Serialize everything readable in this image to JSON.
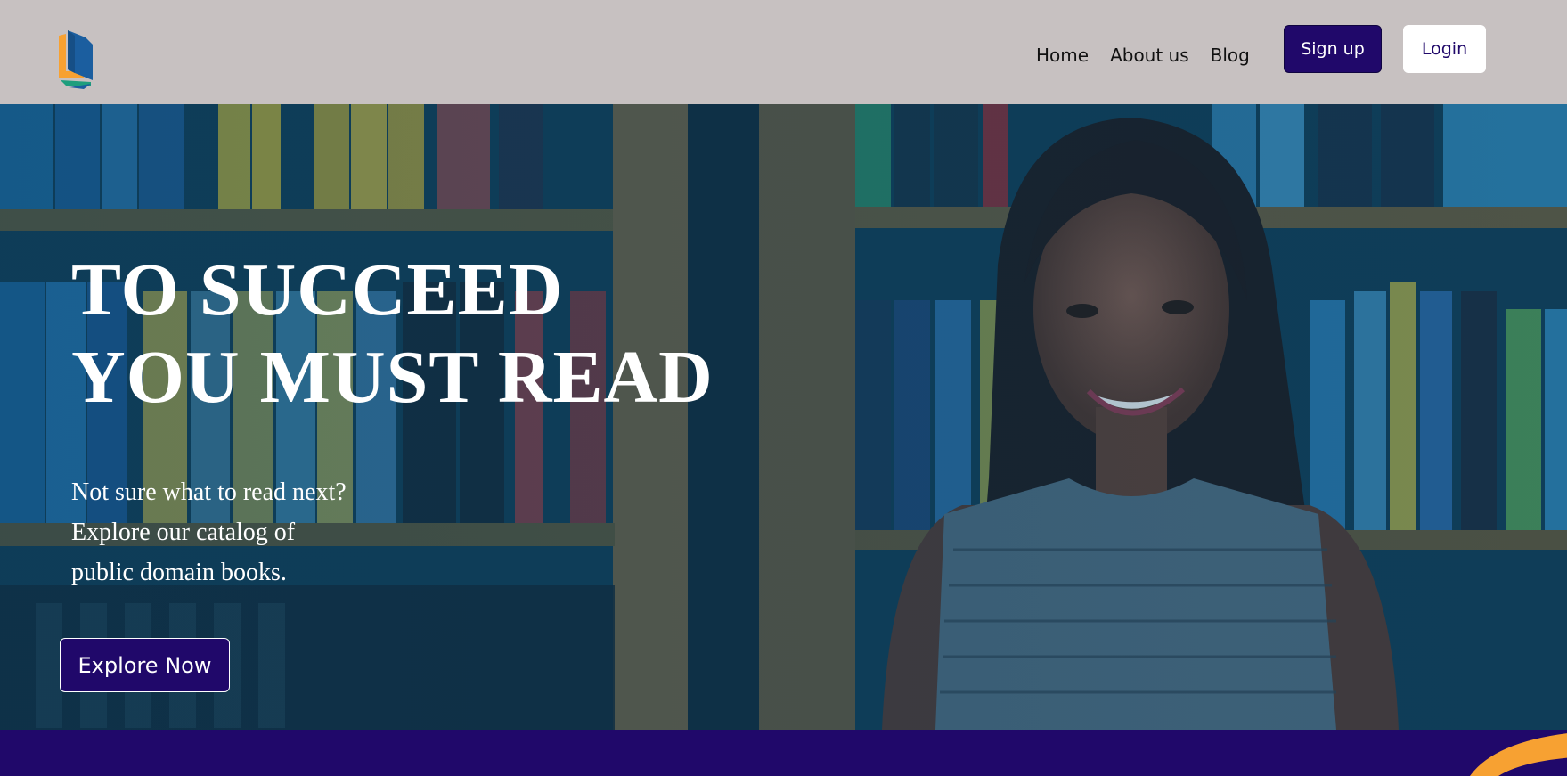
{
  "nav": {
    "items": [
      "Home",
      "About us",
      "Blog"
    ],
    "signup_label": "Sign up",
    "login_label": "Login"
  },
  "hero": {
    "title_line1": "TO SUCCEED",
    "title_line2": "YOU MUST READ",
    "subtitle_line1": "Not sure what to read next?",
    "subtitle_line2": "Explore our catalog of",
    "subtitle_line3": "public domain books.",
    "cta_label": "Explore Now"
  },
  "colors": {
    "header_bg": "#c7c1c1",
    "primary": "#20086a",
    "accent_orange": "#f7a132",
    "logo_blue": "#1b5e9f",
    "logo_green": "#1e9e7d"
  },
  "icons": {
    "logo": "book-logo-icon"
  }
}
